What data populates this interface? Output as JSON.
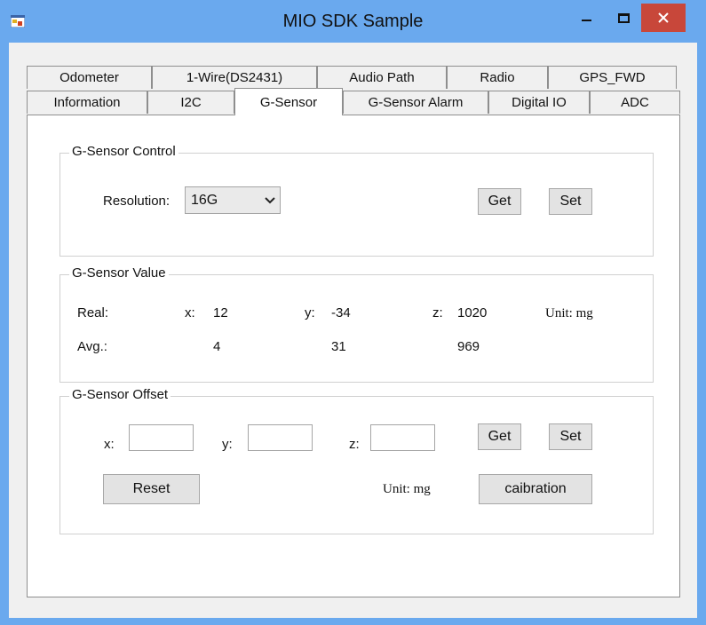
{
  "window": {
    "title": "MIO SDK Sample",
    "icons": {
      "app": "app-icon",
      "minimize": "minimize-icon",
      "maximize": "maximize-icon",
      "close": "close-icon"
    },
    "close_color": "#c8473a",
    "frame_color": "#6aa9ee"
  },
  "tabs": {
    "row_back": [
      "Odometer",
      "1-Wire(DS2431)",
      "Audio Path",
      "Radio",
      "GPS_FWD"
    ],
    "row_front": [
      "Information",
      "I2C",
      "G-Sensor",
      "G-Sensor Alarm",
      "Digital IO",
      "ADC"
    ],
    "selected": "G-Sensor"
  },
  "control": {
    "title": "G-Sensor Control",
    "resolution_label": "Resolution:",
    "resolution_value": "16G",
    "get": "Get",
    "set": "Set"
  },
  "value": {
    "title": "G-Sensor Value",
    "real_label": "Real:",
    "avg_label": "Avg.:",
    "x_label": "x:",
    "y_label": "y:",
    "z_label": "z:",
    "real": {
      "x": "12",
      "y": "-34",
      "z": "1020"
    },
    "avg": {
      "x": "4",
      "y": "31",
      "z": "969"
    },
    "unit": "Unit: mg"
  },
  "offset": {
    "title": "G-Sensor Offset",
    "x_label": "x:",
    "y_label": "y:",
    "z_label": "z:",
    "x_value": "",
    "y_value": "",
    "z_value": "",
    "get": "Get",
    "set": "Set",
    "reset": "Reset",
    "unit": "Unit: mg",
    "calibration": "caibration"
  }
}
